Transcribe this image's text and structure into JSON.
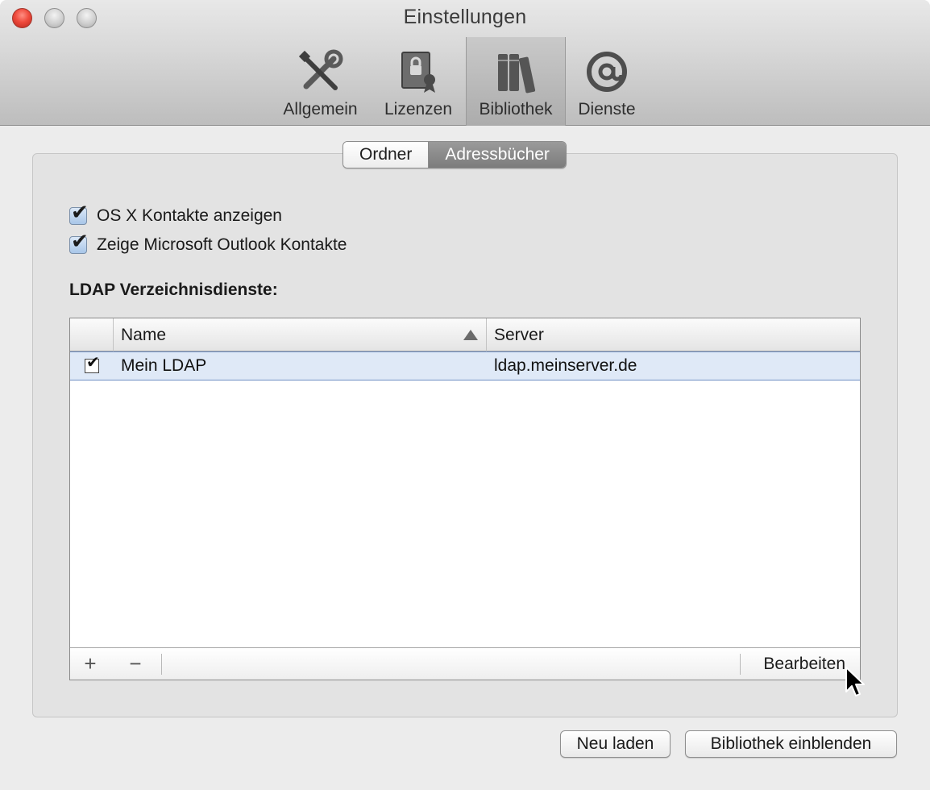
{
  "window": {
    "title": "Einstellungen"
  },
  "toolbar": {
    "items": [
      {
        "label": "Allgemein",
        "icon": "tools-icon",
        "selected": false
      },
      {
        "label": "Lizenzen",
        "icon": "license-certificate-icon",
        "selected": false
      },
      {
        "label": "Bibliothek",
        "icon": "books-icon",
        "selected": true
      },
      {
        "label": "Dienste",
        "icon": "at-sign-icon",
        "selected": false
      }
    ]
  },
  "tabs": [
    {
      "label": "Ordner",
      "active": false
    },
    {
      "label": "Adressbücher",
      "active": true
    }
  ],
  "options": {
    "osx_contacts": {
      "label": "OS X Kontakte anzeigen",
      "checked": true
    },
    "outlook_contacts": {
      "label": "Zeige Microsoft Outlook Kontakte",
      "checked": true
    }
  },
  "ldap": {
    "title": "LDAP Verzeichnisdienste:",
    "columns": {
      "enabled": "",
      "name": "Name",
      "server": "Server"
    },
    "sort": {
      "column": "Name",
      "direction": "ascending"
    },
    "rows": [
      {
        "enabled": true,
        "name": "Mein LDAP",
        "server": "ldap.meinserver.de",
        "selected": true
      }
    ],
    "footer": {
      "add": "+",
      "remove": "−",
      "edit": "Bearbeiten"
    }
  },
  "buttons": {
    "reload": "Neu laden",
    "show_library": "Bibliothek einblenden"
  },
  "colors": {
    "selection": "#dfe9f7",
    "selection_border": "#6f8fc4",
    "close": "#ef4a3c"
  }
}
